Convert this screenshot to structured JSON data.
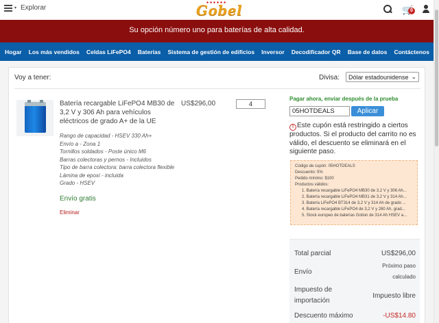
{
  "header": {
    "explore_label": "Explorar",
    "logo_text": "Gobel",
    "cart_count": "0",
    "icons": [
      "search-icon",
      "cart-icon",
      "user-icon",
      "menu-icon"
    ]
  },
  "banner": {
    "text": "Su opción número uno para baterías de alta calidad."
  },
  "nav": {
    "items": [
      "Hogar",
      "Los más vendidos",
      "Celdas LiFePO4",
      "Baterías",
      "Sistema de gestión de edificios",
      "Inversor",
      "Decodificador QR",
      "Base de datos",
      "Contáctenos"
    ]
  },
  "cart": {
    "heading": "Voy a tener:",
    "currency_label": "Divisa:",
    "currency_value": "Dólar estadounidense",
    "product": {
      "title": "Batería recargable LiFePO4 MB30 de 3,2 V y 306 Ah para vehículos eléctricos de grado A+ de la UE",
      "price": "US$296,00",
      "qty": "4",
      "attributes": [
        "Rango de capacidad - HSEV 330 Ah+",
        "Envío a - Zona 1",
        "Tornillos soldados - Poste único M6",
        "Barras colectoras y pernos - Incluidos",
        "Tipo de barra colectora: barra colectora flexible",
        "Lámina de epoxi - incluida",
        "Grado - HSEV"
      ],
      "shipping": "Envío gratis",
      "remove_label": "Eliminar"
    }
  },
  "coupon": {
    "pay_later": "Pagar ahora, enviar después de la prueba",
    "code": "05HOTDEALS",
    "apply_label": "Aplicar",
    "message": "Este cupón está restringido a ciertos productos. Si el producto del carrito no es válido, el descuento se eliminará en el siguiente paso.",
    "details": {
      "code_line": "Código de cupón: 05HOTDEALS",
      "discount_line": "Descuento: 5%",
      "min_line": "Pedido mínimo: $100",
      "valid_label": "Productos válidos:",
      "products": [
        "Batería recargable LiFePO4 MB30 de 3,2 V y 306 Ah...",
        "Batería recargable LiFePO4 MB31 de 3,2 V y 314 Ah...",
        "Batería LiFePO4 BT314 de 3,2 V y 314 Ah de grado ...",
        "Batería recargable LiFePO4 de 3,2 V y 280 Ah, grad...",
        "Stock europeo de baterías Gotion de 314 Ah HSEV a..."
      ]
    }
  },
  "totals": {
    "subtotal_label": "Total parcial",
    "subtotal_value": "US$296,00",
    "shipping_label": "Envío",
    "shipping_value": "Próximo paso calculado",
    "import_label": "Impuesto de importación",
    "import_value": "Impuesto libre",
    "discount_label": "Descuento máximo",
    "discount_value": "-US$14.80"
  },
  "colors": {
    "banner": "#8b0e0e",
    "nav": "#0b5ea8",
    "apply": "#3b8fd8",
    "accent_green": "#2e7d32"
  }
}
